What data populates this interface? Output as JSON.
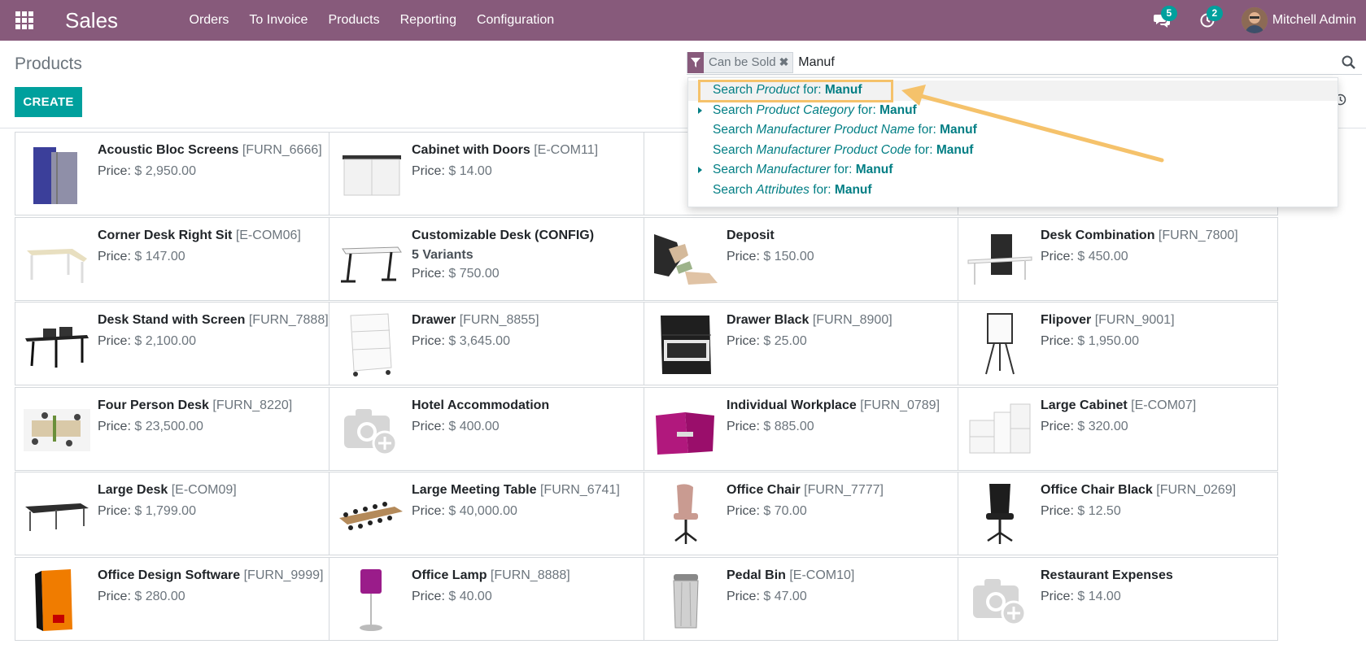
{
  "navbar": {
    "app_name": "Sales",
    "menu": [
      "Orders",
      "To Invoice",
      "Products",
      "Reporting",
      "Configuration"
    ],
    "messages_count": "5",
    "activities_count": "2",
    "user_name": "Mitchell Admin"
  },
  "control_panel": {
    "title": "Products",
    "create_label": "CREATE",
    "facet_label": "Can be Sold",
    "search_value": "Manuf"
  },
  "autocomplete": [
    {
      "prefix": "Search ",
      "field": "Product",
      "mid": " for: ",
      "query": "Manuf",
      "expandable": false
    },
    {
      "prefix": "Search ",
      "field": "Product Category",
      "mid": " for: ",
      "query": "Manuf",
      "expandable": true
    },
    {
      "prefix": "Search ",
      "field": "Manufacturer Product Name",
      "mid": " for: ",
      "query": "Manuf",
      "expandable": false
    },
    {
      "prefix": "Search ",
      "field": "Manufacturer Product Code",
      "mid": " for: ",
      "query": "Manuf",
      "expandable": false
    },
    {
      "prefix": "Search ",
      "field": "Manufacturer",
      "mid": " for: ",
      "query": "Manuf",
      "expandable": true
    },
    {
      "prefix": "Search ",
      "field": "Attributes",
      "mid": " for: ",
      "query": "Manuf",
      "expandable": false
    }
  ],
  "price_label": "Price: ",
  "products": [
    {
      "name": "Acoustic Bloc Screens",
      "code": "[FURN_6666]",
      "price": "$ 2,950.00",
      "image": "acoustic-screens-image"
    },
    {
      "name": "Cabinet with Doors",
      "code": "[E-COM11]",
      "price": "$ 14.00",
      "image": "cabinet-image"
    },
    {
      "name": "",
      "code": "",
      "price": "",
      "image": "hidden-product-image"
    },
    {
      "name": "",
      "code": "",
      "price": "",
      "image": "hidden-product-image"
    },
    {
      "name": "Corner Desk Right Sit",
      "code": "[E-COM06]",
      "price": "$ 147.00",
      "image": "corner-desk-image"
    },
    {
      "name": "Customizable Desk (CONFIG)",
      "code": "",
      "variants": "5 Variants",
      "price": "$ 750.00",
      "image": "desk-image"
    },
    {
      "name": "Deposit",
      "code": "",
      "price": "$ 150.00",
      "image": "money-hands-image"
    },
    {
      "name": "Desk Combination",
      "code": "[FURN_7800]",
      "price": "$ 450.00",
      "image": "desk-combination-image"
    },
    {
      "name": "Desk Stand with Screen",
      "code": "[FURN_7888]",
      "price": "$ 2,100.00",
      "image": "desk-stand-image"
    },
    {
      "name": "Drawer",
      "code": "[FURN_8855]",
      "price": "$ 3,645.00",
      "image": "drawer-image"
    },
    {
      "name": "Drawer Black",
      "code": "[FURN_8900]",
      "price": "$ 25.00",
      "image": "drawer-black-image"
    },
    {
      "name": "Flipover",
      "code": "[FURN_9001]",
      "price": "$ 1,950.00",
      "image": "flipover-image"
    },
    {
      "name": "Four Person Desk",
      "code": "[FURN_8220]",
      "price": "$ 23,500.00",
      "image": "four-person-desk-image"
    },
    {
      "name": "Hotel Accommodation",
      "code": "",
      "price": "$ 400.00",
      "image": "placeholder-camera-image"
    },
    {
      "name": "Individual Workplace",
      "code": "[FURN_0789]",
      "price": "$ 885.00",
      "image": "individual-workplace-image"
    },
    {
      "name": "Large Cabinet",
      "code": "[E-COM07]",
      "price": "$ 320.00",
      "image": "large-cabinet-image"
    },
    {
      "name": "Large Desk",
      "code": "[E-COM09]",
      "price": "$ 1,799.00",
      "image": "large-desk-image"
    },
    {
      "name": "Large Meeting Table",
      "code": "[FURN_6741]",
      "price": "$ 40,000.00",
      "image": "meeting-table-image"
    },
    {
      "name": "Office Chair",
      "code": "[FURN_7777]",
      "price": "$ 70.00",
      "image": "office-chair-image"
    },
    {
      "name": "Office Chair Black",
      "code": "[FURN_0269]",
      "price": "$ 12.50",
      "image": "office-chair-black-image"
    },
    {
      "name": "Office Design Software",
      "code": "[FURN_9999]",
      "price": "$ 280.00",
      "image": "software-box-image"
    },
    {
      "name": "Office Lamp",
      "code": "[FURN_8888]",
      "price": "$ 40.00",
      "image": "lamp-image"
    },
    {
      "name": "Pedal Bin",
      "code": "[E-COM10]",
      "price": "$ 47.00",
      "image": "pedal-bin-image"
    },
    {
      "name": "Restaurant Expenses",
      "code": "",
      "price": "$ 14.00",
      "image": "placeholder-camera-image"
    }
  ],
  "colors": {
    "navbar": "#875a7b",
    "primary": "#00a09d",
    "link": "#017e84",
    "highlight": "#f5c26b"
  }
}
